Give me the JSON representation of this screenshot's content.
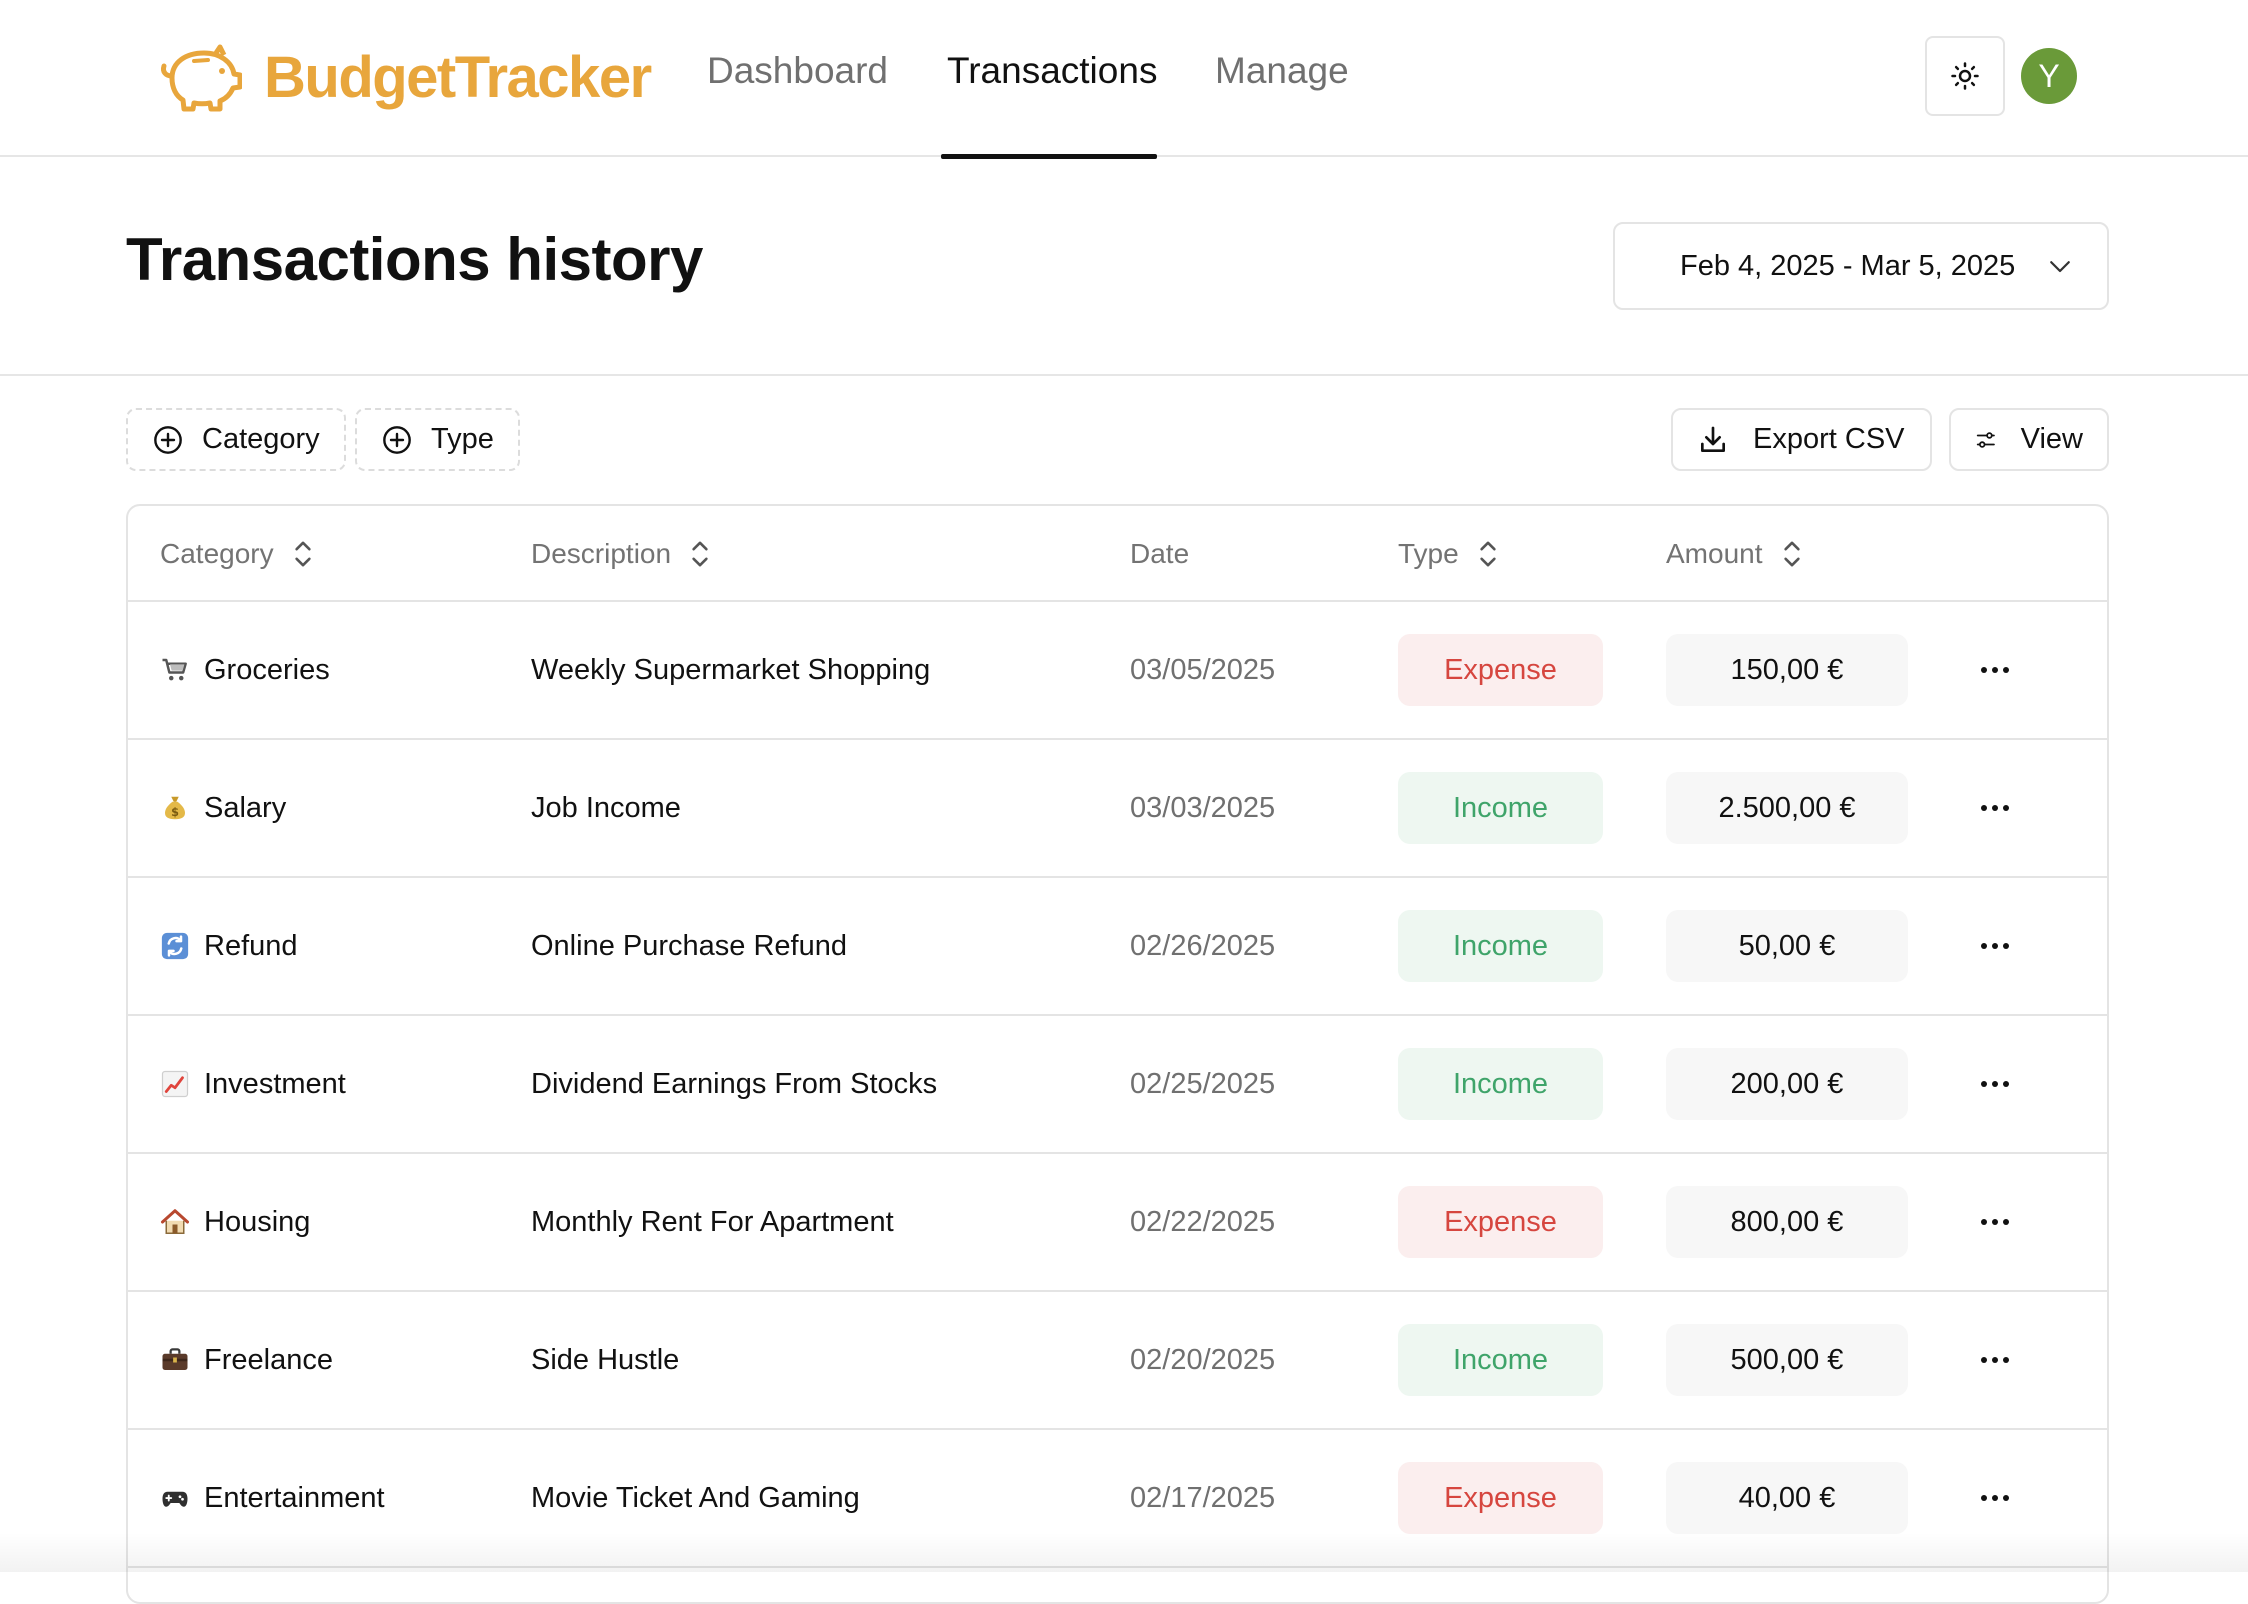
{
  "app": {
    "name": "BudgetTracker",
    "brand_color": "#e8a63c"
  },
  "nav": {
    "links": [
      {
        "label": "Dashboard",
        "active": false
      },
      {
        "label": "Transactions",
        "active": true
      },
      {
        "label": "Manage",
        "active": false
      }
    ],
    "theme_icon": "sun-icon",
    "avatar_initial": "Y",
    "avatar_color": "#6a9a39"
  },
  "page": {
    "title": "Transactions history",
    "date_range": "Feb 4, 2025 - Mar 5, 2025"
  },
  "toolbar": {
    "filters": [
      {
        "label": "Category",
        "icon": "plus-circle-icon"
      },
      {
        "label": "Type",
        "icon": "plus-circle-icon"
      }
    ],
    "export_label": "Export CSV",
    "export_icon": "download-icon",
    "view_label": "View",
    "view_icon": "sliders-icon"
  },
  "table": {
    "columns": [
      {
        "label": "Category",
        "sortable": true
      },
      {
        "label": "Description",
        "sortable": true
      },
      {
        "label": "Date",
        "sortable": false
      },
      {
        "label": "Type",
        "sortable": true
      },
      {
        "label": "Amount",
        "sortable": true
      }
    ],
    "rows": [
      {
        "icon": "shopping-cart-icon",
        "category": "Groceries",
        "description": "Weekly Supermarket Shopping",
        "date": "03/05/2025",
        "type": "Expense",
        "amount": "150,00 €"
      },
      {
        "icon": "money-bag-icon",
        "category": "Salary",
        "description": "Job Income",
        "date": "03/03/2025",
        "type": "Income",
        "amount": "2.500,00 €"
      },
      {
        "icon": "refresh-icon",
        "category": "Refund",
        "description": "Online Purchase Refund",
        "date": "02/26/2025",
        "type": "Income",
        "amount": "50,00 €"
      },
      {
        "icon": "chart-increasing-icon",
        "category": "Investment",
        "description": "Dividend Earnings From Stocks",
        "date": "02/25/2025",
        "type": "Income",
        "amount": "200,00 €"
      },
      {
        "icon": "house-icon",
        "category": "Housing",
        "description": "Monthly Rent For Apartment",
        "date": "02/22/2025",
        "type": "Expense",
        "amount": "800,00 €"
      },
      {
        "icon": "briefcase-icon",
        "category": "Freelance",
        "description": "Side Hustle",
        "date": "02/20/2025",
        "type": "Income",
        "amount": "500,00 €"
      },
      {
        "icon": "game-controller-icon",
        "category": "Entertainment",
        "description": "Movie Ticket And Gaming",
        "date": "02/17/2025",
        "type": "Expense",
        "amount": "40,00 €"
      }
    ],
    "status_colors": {
      "expense_text": "#d6463f",
      "expense_bg": "#fbeeee",
      "income_text": "#3fa46a",
      "income_bg": "#eef7f1"
    }
  }
}
